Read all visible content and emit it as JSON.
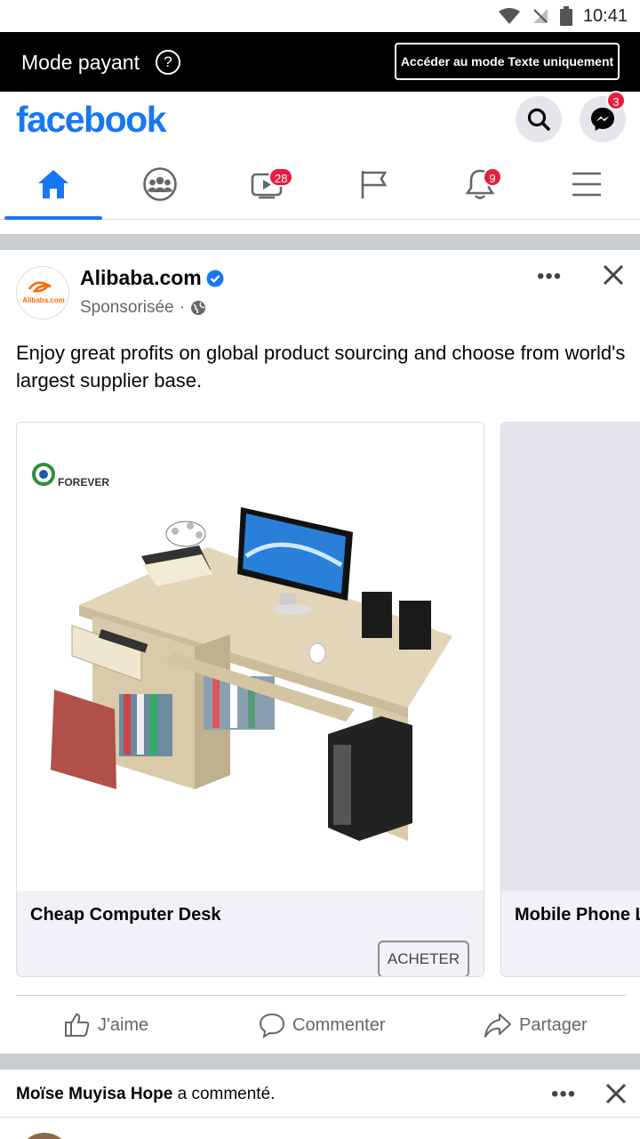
{
  "status_bar": {
    "time": "10:41"
  },
  "paid_banner": {
    "label": "Mode payant",
    "help": "?",
    "text_mode_button": "Accéder au mode Texte uniquement"
  },
  "header": {
    "logo": "facebook",
    "messenger_badge": "3"
  },
  "nav": {
    "watch_badge": "28",
    "notifications_badge": "9"
  },
  "post": {
    "author": "Alibaba.com",
    "meta": "Sponsorisée",
    "meta_sep": "·",
    "more": "•••",
    "avatar_text": "Alibaba.com",
    "text": "Enjoy great profits on global product sourcing and choose from world's largest supplier base.",
    "cards": [
      {
        "brand": "FOREVER",
        "title": "Cheap Computer Desk",
        "cta": "ACHETER"
      },
      {
        "title": "Mobile Phone L"
      }
    ],
    "actions": {
      "like": "J'aime",
      "comment": "Commenter",
      "share": "Partager"
    }
  },
  "next_post": {
    "name": "Moïse Muyisa Hope",
    "action": "a commenté.",
    "more": "•••"
  },
  "colors": {
    "brand": "#1877f2",
    "badge": "#e41e3f",
    "separator": "#c9ccd1"
  }
}
